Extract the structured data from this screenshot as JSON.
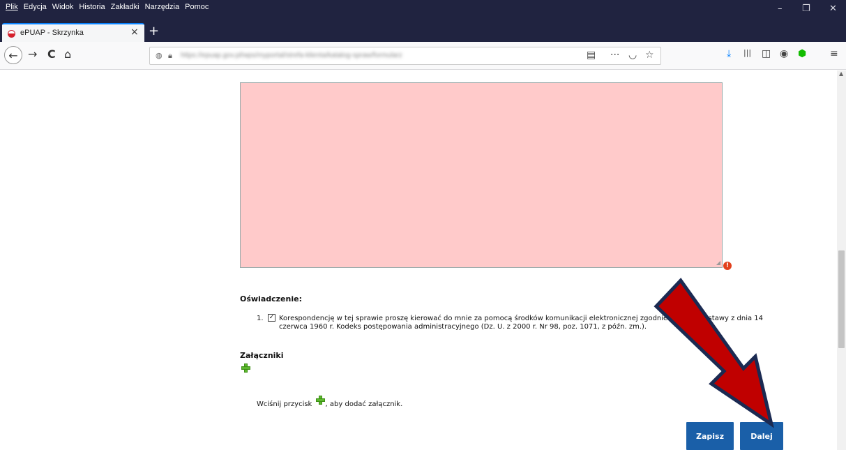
{
  "menu": {
    "items": [
      "Plik",
      "Edycja",
      "Widok",
      "Historia",
      "Zakładki",
      "Narzędzia",
      "Pomoc"
    ]
  },
  "window": {
    "minimize": "–",
    "restore": "❐",
    "close": "✕"
  },
  "tab": {
    "title": "ePUAP - Skrzynka",
    "close": "×",
    "new_tab": "+"
  },
  "nav": {
    "back": "←",
    "forward": "→",
    "reload": "C",
    "home": "⌂",
    "url": "https://epuap.gov.pl/wps/myportal/strefa-klienta/katalog-spraw/formularz"
  },
  "toolbar": {
    "reader": "▤",
    "more": "···",
    "pocket": "◡",
    "bookmark": "☆",
    "download": "⤓",
    "library": "|||",
    "sidebar": "◫",
    "account": "◉",
    "shield": "⬢",
    "menu": "≡"
  },
  "form": {
    "declaration_heading": "Oświadczenie:",
    "declaration_number": "1.",
    "declaration_checkbox": "✓",
    "declaration_line1": "Korespondencję w tej sprawie proszę kierować do mnie za pomocą środków komunikacji elektronicznej zgodnie z art. 39¹ ustawy z dnia 14",
    "declaration_line2": "czerwca 1960 r. Kodeks postępowania administracyjnego (Dz. U. z 2000 r. Nr 98, poz. 1071, z późn. zm.).",
    "attachments_heading": "Załączniki",
    "attachments_hint_before": "Wciśnij przycisk",
    "attachments_hint_after": ", aby dodać załącznik.",
    "error_mark": "!",
    "save_label": "Zapisz",
    "next_label": "Dalej"
  },
  "colors": {
    "textarea_error_bg": "#ffcaca",
    "button_bg": "#1a5fa8",
    "arrow_fill": "#c00000",
    "arrow_outline": "#1b2a52",
    "add_icon": "#5cb82e"
  }
}
